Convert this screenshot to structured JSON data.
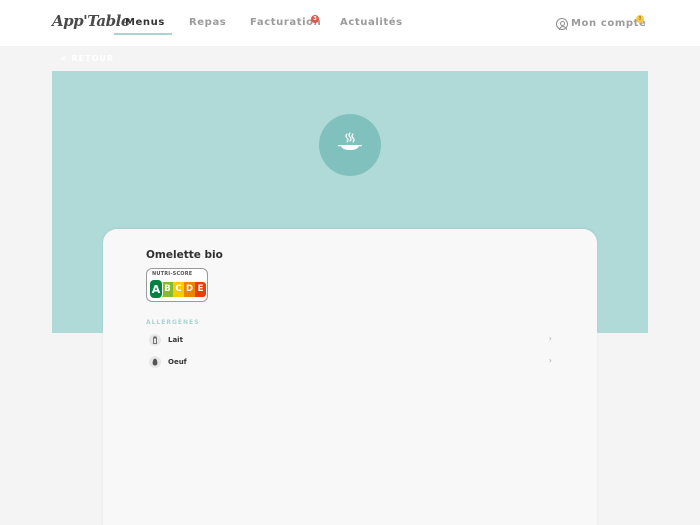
{
  "app": {
    "logo": "App'Table"
  },
  "nav": {
    "tabs": [
      {
        "label": "Menus",
        "active": true
      },
      {
        "label": "Repas",
        "active": false
      },
      {
        "label": "Facturation",
        "active": false
      },
      {
        "label": "Actualités",
        "active": false
      }
    ],
    "facturation_badge": "3",
    "account_label": "Mon compte",
    "account_badge": "!"
  },
  "back_label": "< RETOUR",
  "dish": {
    "name": "Omelette bio",
    "icon": "dish-icon",
    "nutriscore": {
      "label": "NUTRI-SCORE",
      "letters": [
        "A",
        "B",
        "C",
        "D",
        "E"
      ],
      "selected": "A",
      "colors": [
        "#038141",
        "#85bb2f",
        "#fecb02",
        "#ee8100",
        "#e63e11"
      ]
    },
    "allergens_title": "ALLERGÈNES",
    "allergens": [
      {
        "name": "Lait",
        "icon": "milk-bottle-icon"
      },
      {
        "name": "Oeuf",
        "icon": "egg-icon"
      }
    ]
  },
  "colors": {
    "accent": "#a8d5d2",
    "hero_bg": "#b0dad8",
    "hero_circle": "#80c1bd",
    "badge_red": "#e2574c",
    "badge_yellow": "#f5c84c"
  }
}
